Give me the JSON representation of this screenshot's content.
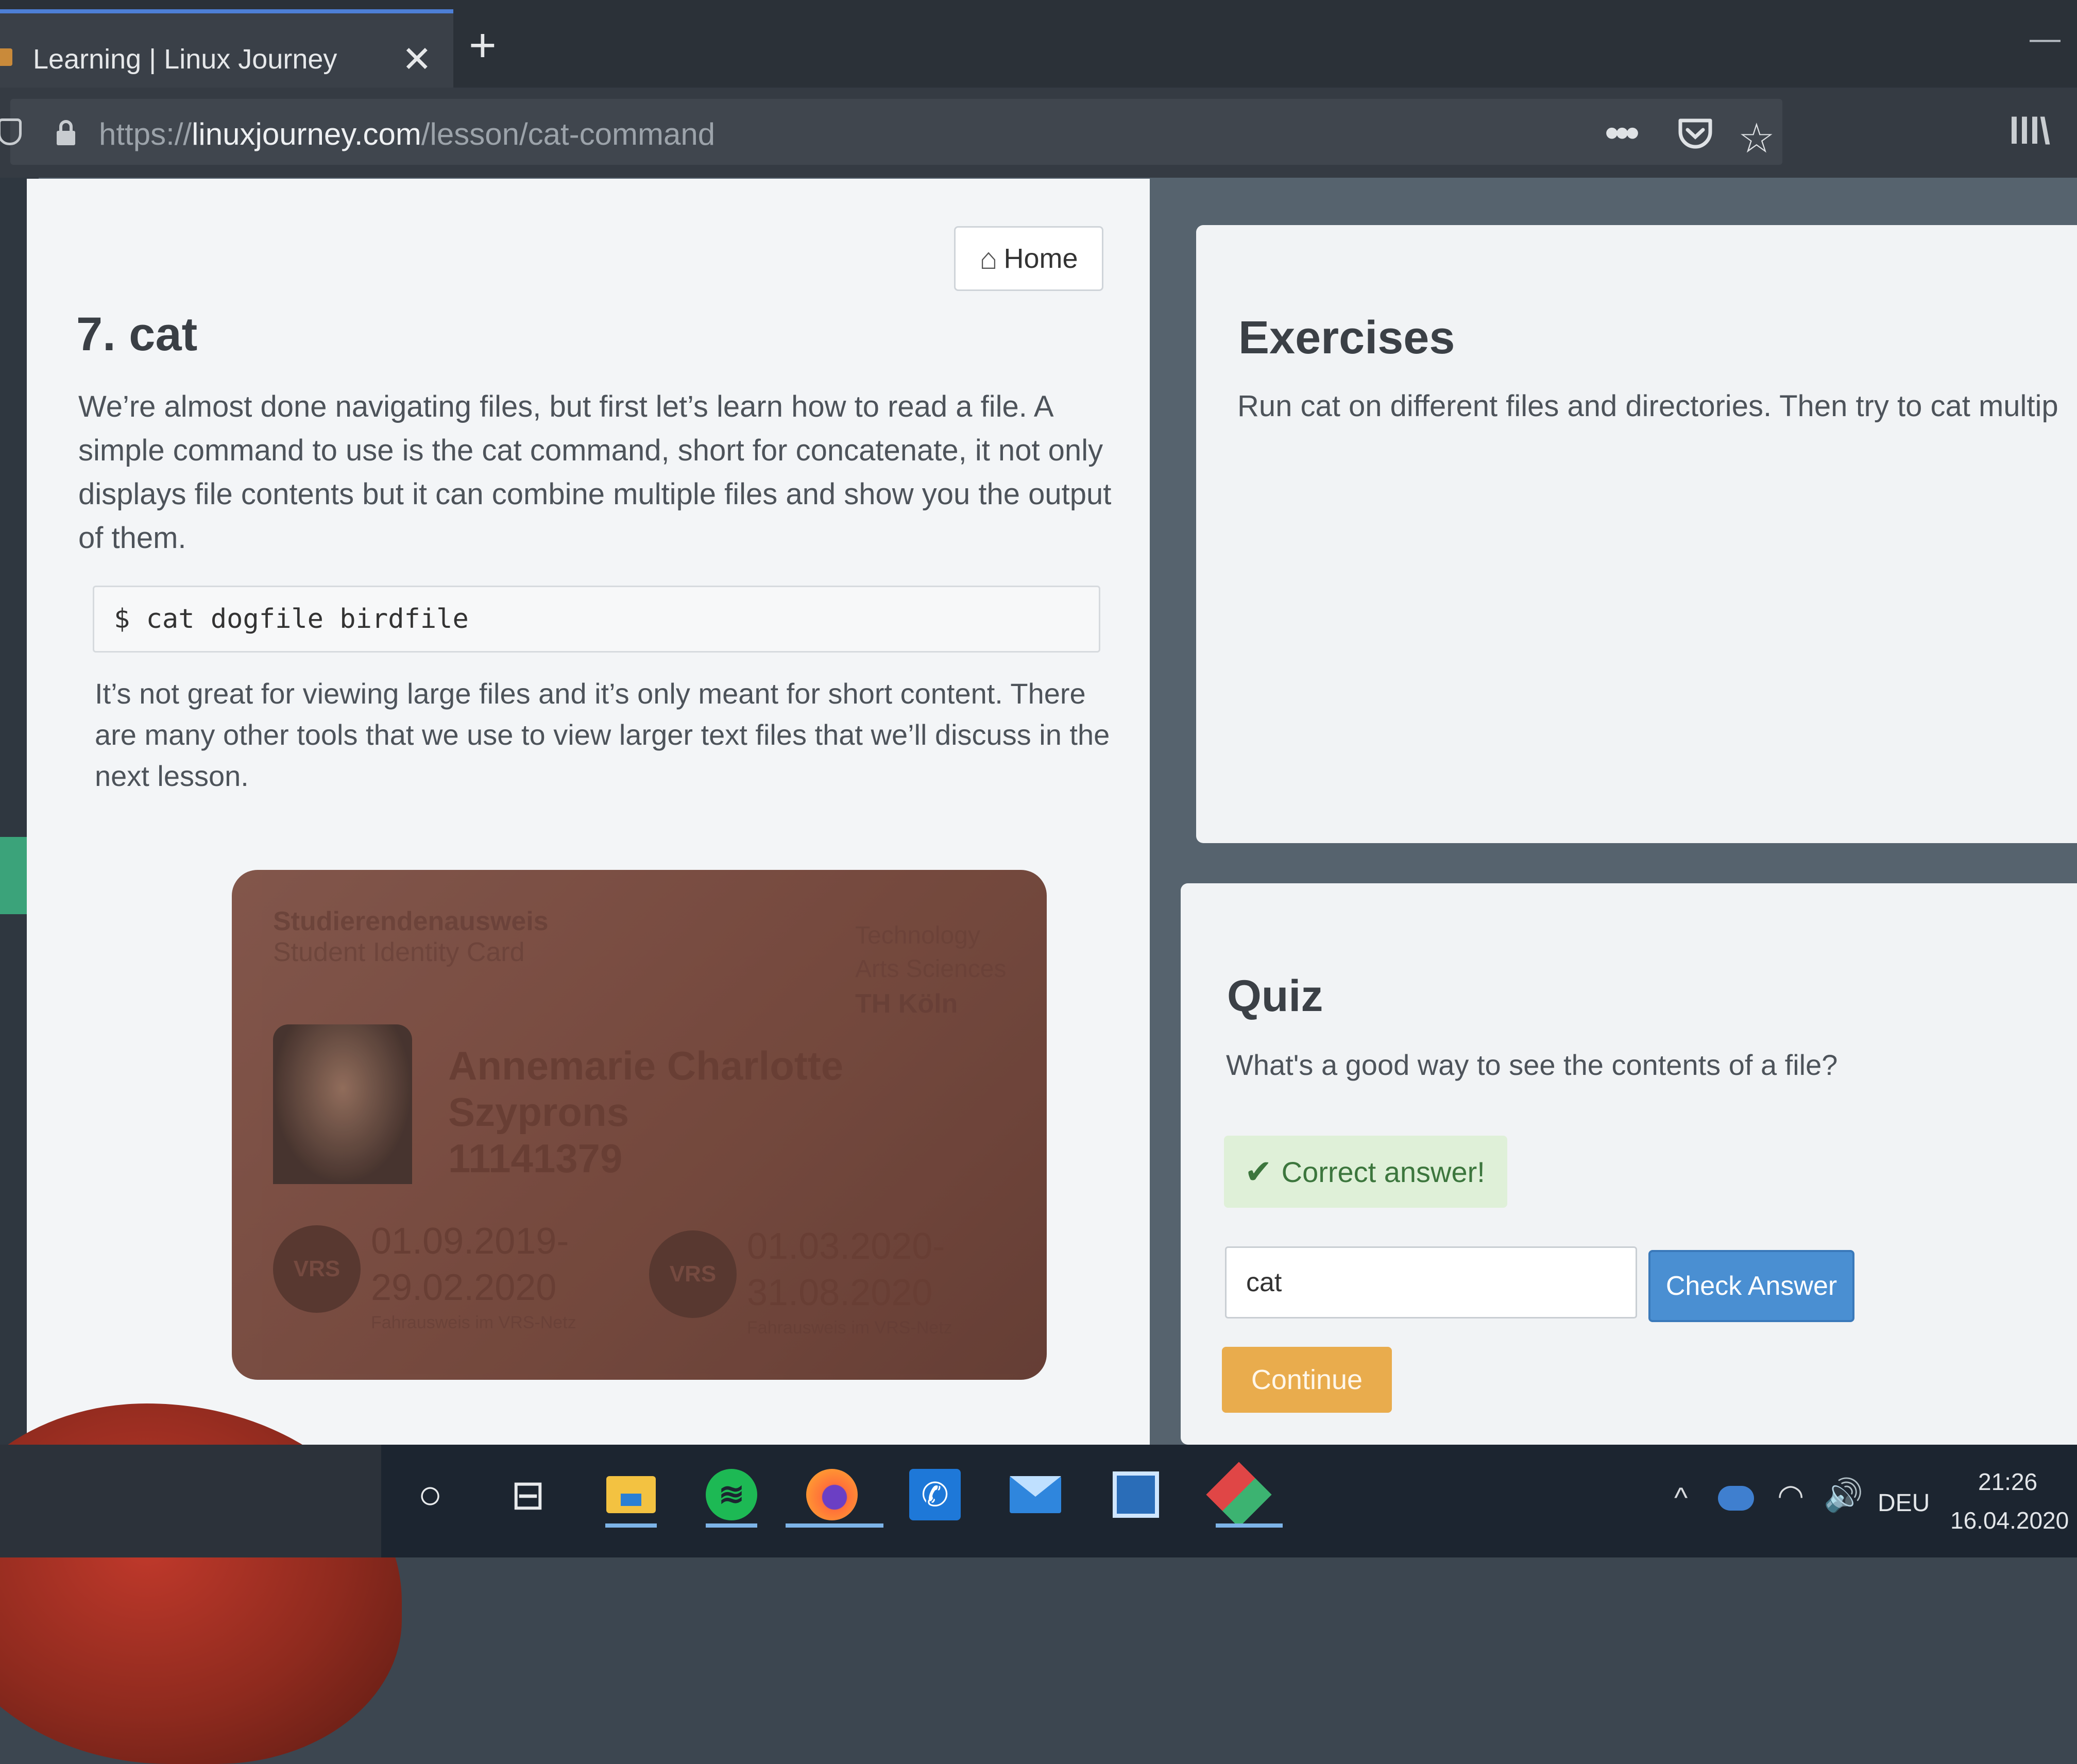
{
  "browser": {
    "tab_title": "Learning | Linux Journey",
    "close_glyph": "✕",
    "new_tab_glyph": "+",
    "minimize_glyph": "—",
    "url_scheme": "https://",
    "url_host": "linuxjourney.com",
    "url_path": "/lesson/cat-command",
    "more_glyph": "•••",
    "star_glyph": "☆",
    "library_glyph": "lll\\"
  },
  "lesson": {
    "home_label": "Home",
    "home_icon": "home-icon",
    "title": "7. cat",
    "paragraph1": "We’re almost done navigating files, but first let’s learn how to read a file. A simple command to use is the cat command, short for concatenate, it not only displays file contents but it can combine multiple files and show you the output of them.",
    "code": "$ cat dogfile birdfile",
    "paragraph2": "It’s not great for viewing large files and it’s only meant for short content. There are many other tools that we use to view larger text files that we’ll discuss in the next lesson."
  },
  "id_card": {
    "label_de": "Studierendenausweis",
    "label_en": "Student Identity Card",
    "institution_line1": "Technology",
    "institution_line2": "Arts Sciences",
    "institution_line3": "TH Köln",
    "name_line1": "Annemarie Charlotte",
    "name_line2": "Szyprons",
    "student_id": "11141379",
    "seal_text": "VRS",
    "period1_start": "01.09.2019-",
    "period1_end": "29.02.2020",
    "period1_note": "Fahrausweis im VRS-Netz",
    "period2_start": "01.03.2020-",
    "period2_end": "31.08.2020",
    "period2_note": "Fahrausweis im VRS-Netz"
  },
  "exercises": {
    "title": "Exercises",
    "text": "Run cat on different files and directories. Then try to cat multip"
  },
  "quiz": {
    "title": "Quiz",
    "question": "What's a good way to see the contents of a file?",
    "feedback": "Correct answer!",
    "check_glyph": "✔",
    "answer_value": "cat",
    "check_button_label": "Check Answer",
    "continue_label": "Continue"
  },
  "taskbar": {
    "search_glyph": "○",
    "taskview_glyph": "⊟",
    "whatsapp_glyph": "✆",
    "spotify_glyph": "≋",
    "tray_chevron": "^",
    "wifi_glyph": "◠",
    "volume_glyph": "🔊",
    "language": "DEU",
    "time": "21:26",
    "date": "16.04.2020",
    "active_underline_color": "#7db4e8"
  },
  "colors": {
    "check_button": "#4a8fd2",
    "continue_button": "#e9ac4d",
    "correct_banner": "#dff0d8",
    "tab_accent": "#4d7fd6"
  }
}
